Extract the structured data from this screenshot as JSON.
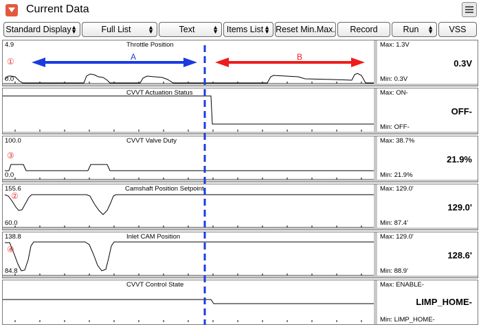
{
  "window": {
    "title": "Current Data"
  },
  "toolbar": {
    "buttons": [
      {
        "label": "Standard Display",
        "dropdown": true
      },
      {
        "label": "Full List",
        "dropdown": true
      },
      {
        "label": "Text",
        "dropdown": true
      },
      {
        "label": "Items List",
        "dropdown": true
      },
      {
        "label": "Reset Min.Max.",
        "dropdown": false
      },
      {
        "label": "Record",
        "dropdown": false
      },
      {
        "label": "Run",
        "dropdown": true
      },
      {
        "label": "VSS",
        "dropdown": false
      }
    ]
  },
  "annotations": {
    "region_a": "A",
    "region_b": "B",
    "colors": {
      "a_arrow": "#1a3be0",
      "b_arrow": "#ee1c1c",
      "divider": "#1a3be0",
      "badge": "#e53935"
    }
  },
  "charts": [
    {
      "title": "Throttle Position",
      "y_top": "4.9",
      "y_bottom": "0.0",
      "badge": "①",
      "max": "Max:  1.3V",
      "min": "Min:  0.3V",
      "current": "0.3V"
    },
    {
      "title": "CVVT Actuation Status",
      "y_top": "",
      "y_bottom": "",
      "badge": "",
      "max": "Max: ON-",
      "min": "Min:  OFF-",
      "current": "OFF-"
    },
    {
      "title": "CVVT Valve Duty",
      "y_top": "100.0",
      "y_bottom": "0.0",
      "badge": "③",
      "max": "Max:  38.7%",
      "min": "Min:  21.9%",
      "current": "21.9%"
    },
    {
      "title": "Camshaft Position Setpoint",
      "y_top": "155.6",
      "y_bottom": "60.0",
      "badge": "②",
      "max": "Max: 129.0'",
      "min": "Min:  87.4'",
      "current": "129.0'"
    },
    {
      "title": "Inlet CAM Position",
      "y_top": "138.8",
      "y_bottom": "84.8",
      "badge": "④",
      "max": "Max: 129.0'",
      "min": "Min:  88.9'",
      "current": "128.6'"
    },
    {
      "title": "CVVT Control State",
      "y_top": "",
      "y_bottom": "",
      "badge": "",
      "max": "Max: ENABLE-",
      "min": "Min: LIMP_HOME-",
      "current": "LIMP_HOME-"
    }
  ]
}
